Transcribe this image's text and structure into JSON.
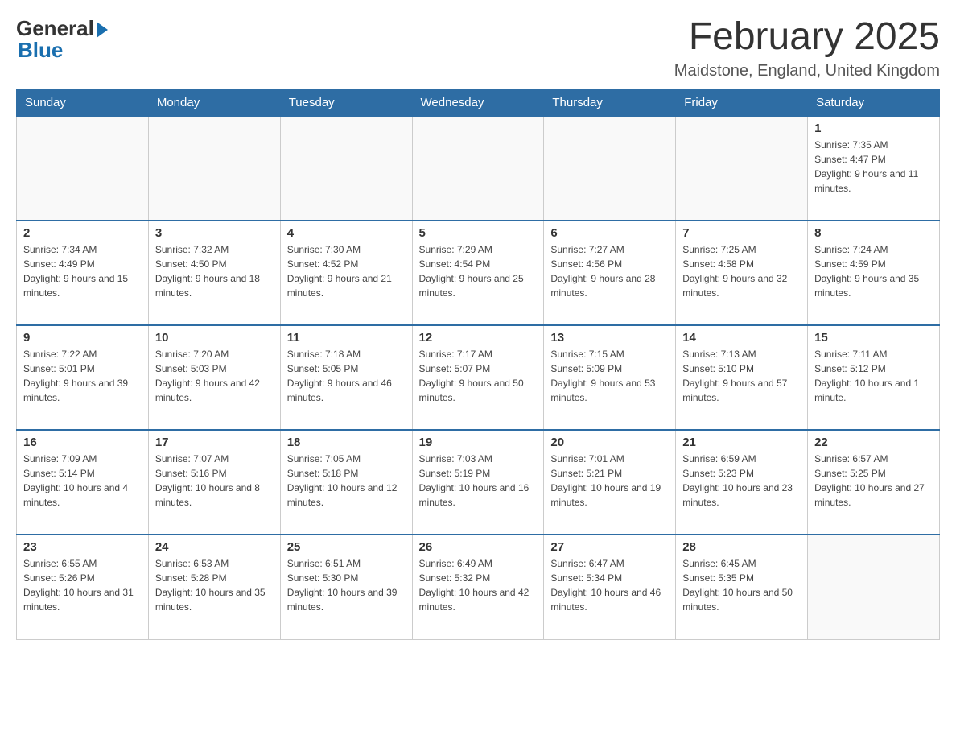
{
  "header": {
    "logo_text1": "General",
    "logo_text2": "Blue",
    "title": "February 2025",
    "subtitle": "Maidstone, England, United Kingdom"
  },
  "weekdays": [
    "Sunday",
    "Monday",
    "Tuesday",
    "Wednesday",
    "Thursday",
    "Friday",
    "Saturday"
  ],
  "weeks": [
    [
      {
        "day": "",
        "info": ""
      },
      {
        "day": "",
        "info": ""
      },
      {
        "day": "",
        "info": ""
      },
      {
        "day": "",
        "info": ""
      },
      {
        "day": "",
        "info": ""
      },
      {
        "day": "",
        "info": ""
      },
      {
        "day": "1",
        "info": "Sunrise: 7:35 AM\nSunset: 4:47 PM\nDaylight: 9 hours and 11 minutes."
      }
    ],
    [
      {
        "day": "2",
        "info": "Sunrise: 7:34 AM\nSunset: 4:49 PM\nDaylight: 9 hours and 15 minutes."
      },
      {
        "day": "3",
        "info": "Sunrise: 7:32 AM\nSunset: 4:50 PM\nDaylight: 9 hours and 18 minutes."
      },
      {
        "day": "4",
        "info": "Sunrise: 7:30 AM\nSunset: 4:52 PM\nDaylight: 9 hours and 21 minutes."
      },
      {
        "day": "5",
        "info": "Sunrise: 7:29 AM\nSunset: 4:54 PM\nDaylight: 9 hours and 25 minutes."
      },
      {
        "day": "6",
        "info": "Sunrise: 7:27 AM\nSunset: 4:56 PM\nDaylight: 9 hours and 28 minutes."
      },
      {
        "day": "7",
        "info": "Sunrise: 7:25 AM\nSunset: 4:58 PM\nDaylight: 9 hours and 32 minutes."
      },
      {
        "day": "8",
        "info": "Sunrise: 7:24 AM\nSunset: 4:59 PM\nDaylight: 9 hours and 35 minutes."
      }
    ],
    [
      {
        "day": "9",
        "info": "Sunrise: 7:22 AM\nSunset: 5:01 PM\nDaylight: 9 hours and 39 minutes."
      },
      {
        "day": "10",
        "info": "Sunrise: 7:20 AM\nSunset: 5:03 PM\nDaylight: 9 hours and 42 minutes."
      },
      {
        "day": "11",
        "info": "Sunrise: 7:18 AM\nSunset: 5:05 PM\nDaylight: 9 hours and 46 minutes."
      },
      {
        "day": "12",
        "info": "Sunrise: 7:17 AM\nSunset: 5:07 PM\nDaylight: 9 hours and 50 minutes."
      },
      {
        "day": "13",
        "info": "Sunrise: 7:15 AM\nSunset: 5:09 PM\nDaylight: 9 hours and 53 minutes."
      },
      {
        "day": "14",
        "info": "Sunrise: 7:13 AM\nSunset: 5:10 PM\nDaylight: 9 hours and 57 minutes."
      },
      {
        "day": "15",
        "info": "Sunrise: 7:11 AM\nSunset: 5:12 PM\nDaylight: 10 hours and 1 minute."
      }
    ],
    [
      {
        "day": "16",
        "info": "Sunrise: 7:09 AM\nSunset: 5:14 PM\nDaylight: 10 hours and 4 minutes."
      },
      {
        "day": "17",
        "info": "Sunrise: 7:07 AM\nSunset: 5:16 PM\nDaylight: 10 hours and 8 minutes."
      },
      {
        "day": "18",
        "info": "Sunrise: 7:05 AM\nSunset: 5:18 PM\nDaylight: 10 hours and 12 minutes."
      },
      {
        "day": "19",
        "info": "Sunrise: 7:03 AM\nSunset: 5:19 PM\nDaylight: 10 hours and 16 minutes."
      },
      {
        "day": "20",
        "info": "Sunrise: 7:01 AM\nSunset: 5:21 PM\nDaylight: 10 hours and 19 minutes."
      },
      {
        "day": "21",
        "info": "Sunrise: 6:59 AM\nSunset: 5:23 PM\nDaylight: 10 hours and 23 minutes."
      },
      {
        "day": "22",
        "info": "Sunrise: 6:57 AM\nSunset: 5:25 PM\nDaylight: 10 hours and 27 minutes."
      }
    ],
    [
      {
        "day": "23",
        "info": "Sunrise: 6:55 AM\nSunset: 5:26 PM\nDaylight: 10 hours and 31 minutes."
      },
      {
        "day": "24",
        "info": "Sunrise: 6:53 AM\nSunset: 5:28 PM\nDaylight: 10 hours and 35 minutes."
      },
      {
        "day": "25",
        "info": "Sunrise: 6:51 AM\nSunset: 5:30 PM\nDaylight: 10 hours and 39 minutes."
      },
      {
        "day": "26",
        "info": "Sunrise: 6:49 AM\nSunset: 5:32 PM\nDaylight: 10 hours and 42 minutes."
      },
      {
        "day": "27",
        "info": "Sunrise: 6:47 AM\nSunset: 5:34 PM\nDaylight: 10 hours and 46 minutes."
      },
      {
        "day": "28",
        "info": "Sunrise: 6:45 AM\nSunset: 5:35 PM\nDaylight: 10 hours and 50 minutes."
      },
      {
        "day": "",
        "info": ""
      }
    ]
  ]
}
